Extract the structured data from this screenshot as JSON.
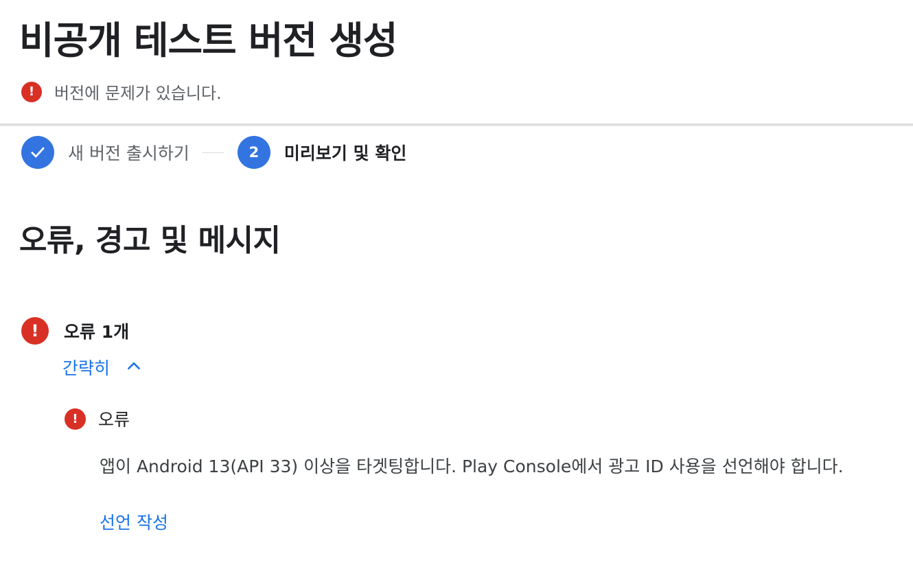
{
  "header": {
    "title": "비공개 테스트 버전 생성",
    "status": {
      "icon": "error-icon",
      "text": "버전에 문제가 있습니다."
    }
  },
  "stepper": {
    "steps": [
      {
        "state": "completed",
        "icon": "check-icon",
        "label": "새 버전 출시하기"
      },
      {
        "state": "active",
        "number": "2",
        "label": "미리보기 및 확인"
      }
    ]
  },
  "review": {
    "title": "오류, 경고 및 메시지",
    "errors": {
      "summary": "오류 1개",
      "toggle_label": "간략히",
      "toggle_icon": "chevron-up-icon",
      "items": [
        {
          "title": "오류",
          "message": "앱이 Android 13(API 33) 이상을 타겟팅합니다. Play Console에서 광고 ID 사용을 선언해야 합니다.",
          "action_label": "선언 작성"
        }
      ]
    }
  },
  "colors": {
    "error": "#d93025",
    "primary": "#3374e0",
    "link": "#1a73e8"
  }
}
